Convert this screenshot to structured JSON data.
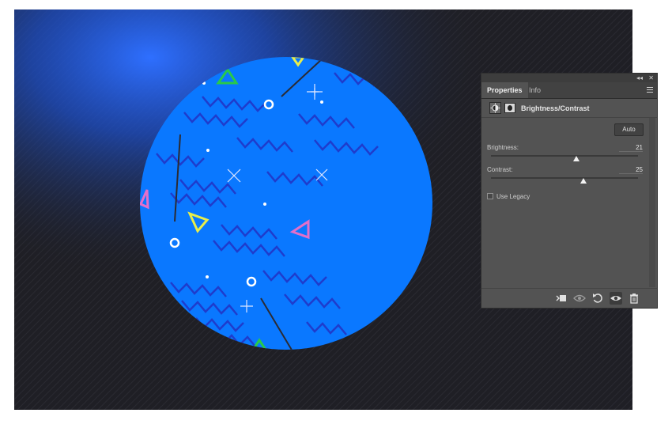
{
  "panel": {
    "tabs": [
      {
        "label": "Properties",
        "active": true
      },
      {
        "label": "Info",
        "active": false
      }
    ],
    "collapse_glyph": "◂◂",
    "close_glyph": "✕",
    "adjustment": {
      "title": "Brightness/Contrast",
      "auto_label": "Auto",
      "brightness": {
        "label": "Brightness:",
        "value": "21",
        "slider_fraction": 0.58
      },
      "contrast": {
        "label": "Contrast:",
        "value": "25",
        "slider_fraction": 0.63
      },
      "use_legacy": {
        "label": "Use Legacy",
        "checked": false
      }
    },
    "bottom_icons": [
      "clip-to-layer-icon",
      "view-previous-icon",
      "reset-icon",
      "visibility-eye-icon",
      "trash-icon"
    ]
  },
  "colors": {
    "circle_fill": "#0a78ff",
    "zigzag": "#1f3ccc",
    "triangle_green": "#29c94a",
    "triangle_yellow": "#e8ee4a",
    "triangle_pink": "#e36fc9",
    "background_dark": "#1f1f25",
    "glow": "#2e6fff"
  }
}
